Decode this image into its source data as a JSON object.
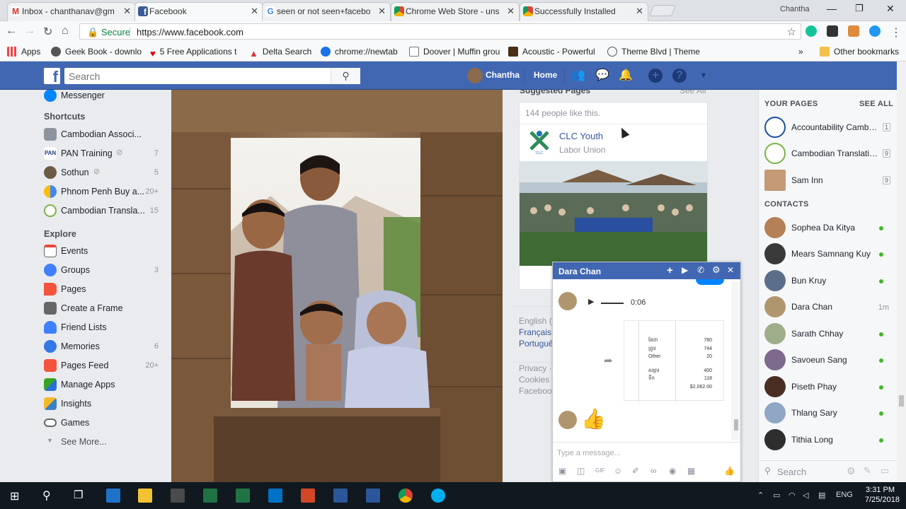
{
  "browser": {
    "tabs": [
      {
        "label": "Inbox - chanthanav@gm",
        "favicon": "gmail-icon",
        "color": "#d93025",
        "active": false
      },
      {
        "label": "Facebook",
        "favicon": "facebook-icon",
        "color": "#3b5998",
        "active": true
      },
      {
        "label": "seen or not seen+facebo",
        "favicon": "google-icon",
        "color": "#4285f4",
        "active": false
      },
      {
        "label": "Chrome Web Store - uns",
        "favicon": "chrome-webstore-icon",
        "color": "#34a853",
        "active": false
      },
      {
        "label": "Successfully Installed",
        "favicon": "chrome-webstore-icon",
        "color": "#34a853",
        "active": false
      }
    ],
    "profile_name": "Chantha",
    "secure_label": "Secure",
    "url": "https://www.facebook.com",
    "bookmarks": [
      {
        "label": "Apps",
        "icon": "apps-grid-icon"
      },
      {
        "label": "Geek Book - downlo",
        "icon": "geekbook-icon"
      },
      {
        "label": "5 Free Applications t",
        "icon": "heart-icon"
      },
      {
        "label": "Delta Search",
        "icon": "delta-icon"
      },
      {
        "label": "chrome://newtab",
        "icon": "globe-icon"
      },
      {
        "label": "Doover | Muffin grou",
        "icon": "page-icon"
      },
      {
        "label": "Acoustic - Powerful",
        "icon": "acoustic-icon"
      },
      {
        "label": "Theme Blvd | Theme",
        "icon": "themeblvd-icon"
      }
    ],
    "other_bookmarks": "Other bookmarks"
  },
  "facebook": {
    "search_placeholder": "Search",
    "user_name": "Chantha",
    "home_label": "Home"
  },
  "left_nav": {
    "messenger": "Messenger",
    "shortcuts_title": "Shortcuts",
    "shortcuts": [
      {
        "label": "Cambodian Associ...",
        "count": ""
      },
      {
        "label": "PAN Training",
        "count": "7"
      },
      {
        "label": "Sothun",
        "count": "5"
      },
      {
        "label": "Phnom Penh Buy a...",
        "count": "20+"
      },
      {
        "label": "Cambodian Transla...",
        "count": "15"
      }
    ],
    "explore_title": "Explore",
    "explore": [
      {
        "label": "Events",
        "count": "",
        "icon": "calendar-icon",
        "color": "#e9473b"
      },
      {
        "label": "Groups",
        "count": "3",
        "icon": "groups-icon",
        "color": "#4080ff"
      },
      {
        "label": "Pages",
        "count": "",
        "icon": "flag-icon",
        "color": "#f5533d"
      },
      {
        "label": "Create a Frame",
        "count": "",
        "icon": "camera-icon",
        "color": "#888"
      },
      {
        "label": "Friend Lists",
        "count": "",
        "icon": "friends-icon",
        "color": "#4080ff"
      },
      {
        "label": "Memories",
        "count": "6",
        "icon": "clock-icon",
        "color": "#3578e5"
      },
      {
        "label": "Pages Feed",
        "count": "20+",
        "icon": "pages-feed-icon",
        "color": "#f5533d"
      },
      {
        "label": "Manage Apps",
        "count": "",
        "icon": "cube-icon",
        "color": "#36a420"
      },
      {
        "label": "Insights",
        "count": "",
        "icon": "insights-icon",
        "color": "#3b82c4"
      },
      {
        "label": "Games",
        "count": "",
        "icon": "gamepad-icon",
        "color": "#666"
      }
    ],
    "see_more": "See More..."
  },
  "right_column": {
    "section_title": "Suggested Pages",
    "see_all": "See All",
    "likes_text": "144 people like this.",
    "page_name": "CLC Youth",
    "page_category": "Labor Union",
    "languages": [
      "English (",
      "Français",
      "Portuguê"
    ],
    "footer_links": [
      "Privacy ·",
      "Cookies",
      "Faceboo"
    ]
  },
  "sidebar": {
    "your_pages_title": "YOUR PAGES",
    "see_all": "SEE ALL",
    "pages": [
      {
        "name": "Accountability Cambodia",
        "badge": "1"
      },
      {
        "name": "Cambodian Translatio...",
        "badge": "9"
      },
      {
        "name": "Sam Inn",
        "badge": "9"
      }
    ],
    "contacts_title": "CONTACTS",
    "contacts": [
      {
        "name": "Sophea Da Kitya",
        "status": "online",
        "time": ""
      },
      {
        "name": "Mears Samnang Kuy",
        "status": "online",
        "time": ""
      },
      {
        "name": "Bun Kruy",
        "status": "online",
        "time": ""
      },
      {
        "name": "Dara Chan",
        "status": "idle",
        "time": "1m"
      },
      {
        "name": "Sarath Chhay",
        "status": "online",
        "time": ""
      },
      {
        "name": "Savoeun Sang",
        "status": "online",
        "time": ""
      },
      {
        "name": "Piseth Phay",
        "status": "online",
        "time": ""
      },
      {
        "name": "Thlang Sary",
        "status": "online",
        "time": ""
      },
      {
        "name": "Tithia Long",
        "status": "online",
        "time": ""
      }
    ],
    "search_placeholder": "Search"
  },
  "chat": {
    "contact_name": "Dara Chan",
    "audio_duration": "0:06",
    "receipt_rows": [
      {
        "label": "ផែនា",
        "value": "780"
      },
      {
        "label": "ព្រូន",
        "value": "744"
      },
      {
        "label": "Other",
        "value": "20"
      },
      {
        "label": "សម្ភារ",
        "value": "400"
      },
      {
        "label": "ទឹក",
        "value": "118"
      }
    ],
    "receipt_total": "$2,062.00",
    "input_placeholder": "Type a message..."
  },
  "taskbar": {
    "language": "ENG",
    "time": "3:31 PM",
    "date": "7/25/2018"
  }
}
